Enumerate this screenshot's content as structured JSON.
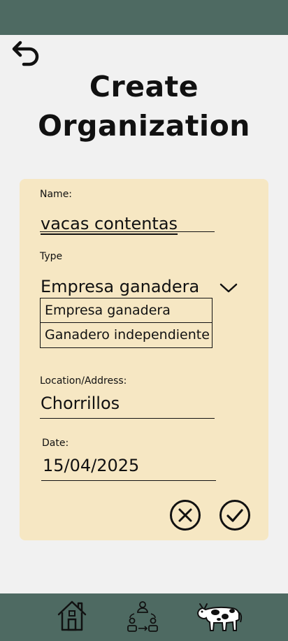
{
  "header": {
    "title_line1": "Create",
    "title_line2": "Organization"
  },
  "form": {
    "name_label": "Name:",
    "name_value": "vacas contentas",
    "type_label": "Type",
    "type_selected": "Empresa ganadera",
    "type_options": [
      "Empresa ganadera",
      "Ganadero independiente"
    ],
    "location_label": "Location/Address:",
    "location_value": "Chorrillos",
    "date_label": "Date:",
    "date_value": "15/04/2025"
  },
  "actions": {
    "cancel_icon": "circle-x-icon",
    "confirm_icon": "circle-check-icon"
  },
  "bottom_nav": {
    "items": [
      "home-icon",
      "organization-network-icon",
      "cow-icon"
    ]
  },
  "colors": {
    "bar": "#4e6a62",
    "background": "#f1f1f1",
    "card": "#f6e7c3"
  }
}
